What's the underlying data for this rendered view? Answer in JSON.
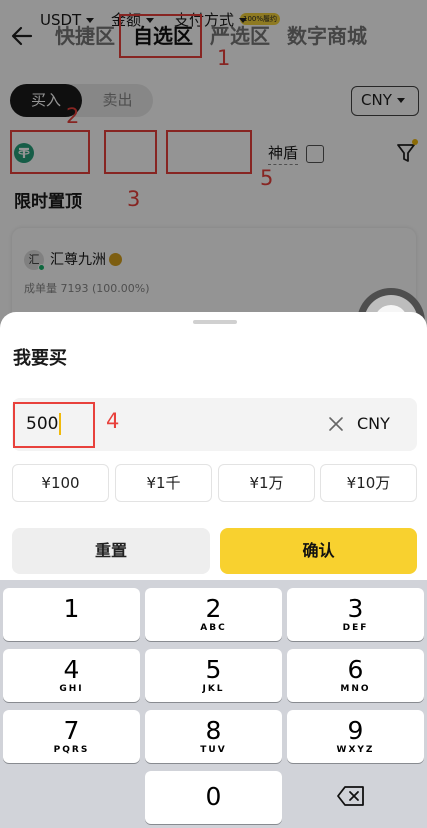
{
  "header": {
    "tabs": [
      {
        "label": "快捷区"
      },
      {
        "label": "自选区"
      },
      {
        "label": "严选区"
      },
      {
        "label": "数字商城"
      }
    ],
    "strict_badge": "100%履约"
  },
  "segment": {
    "buy": "买入",
    "sell": "卖出"
  },
  "currency_selector": {
    "value": "CNY"
  },
  "filters": {
    "coin": "USDT",
    "amount": "金额",
    "payment": "支付方式",
    "shield": "神盾"
  },
  "section": {
    "title": "限时置顶"
  },
  "merchant": {
    "avatar_char": "汇",
    "name": "汇尊九洲",
    "trade_label": "成单量",
    "trade_value": "7193 (100.00%)"
  },
  "annotations": [
    "1",
    "2",
    "3",
    "4",
    "5"
  ],
  "sheet": {
    "title": "我要买",
    "amount_value": "500",
    "currency": "CNY",
    "quick_amounts": [
      "¥100",
      "¥1千",
      "¥1万",
      "¥10万"
    ],
    "reset_label": "重置",
    "confirm_label": "确认"
  },
  "keypad": {
    "keys": [
      {
        "digit": "1",
        "letters": ""
      },
      {
        "digit": "2",
        "letters": "ABC"
      },
      {
        "digit": "3",
        "letters": "DEF"
      },
      {
        "digit": "4",
        "letters": "GHI"
      },
      {
        "digit": "5",
        "letters": "JKL"
      },
      {
        "digit": "6",
        "letters": "MNO"
      },
      {
        "digit": "7",
        "letters": "PQRS"
      },
      {
        "digit": "8",
        "letters": "TUV"
      },
      {
        "digit": "9",
        "letters": "WXYZ"
      }
    ],
    "zero": "0"
  },
  "icons": [
    "back-arrow-icon",
    "usdt-coin-icon",
    "filter-funnel-icon",
    "verified-icon",
    "clear-icon",
    "backspace-icon"
  ],
  "colors": {
    "accent": "#f8d12f",
    "annotation": "#e8413c",
    "buy_bg": "#1b1b1b"
  }
}
